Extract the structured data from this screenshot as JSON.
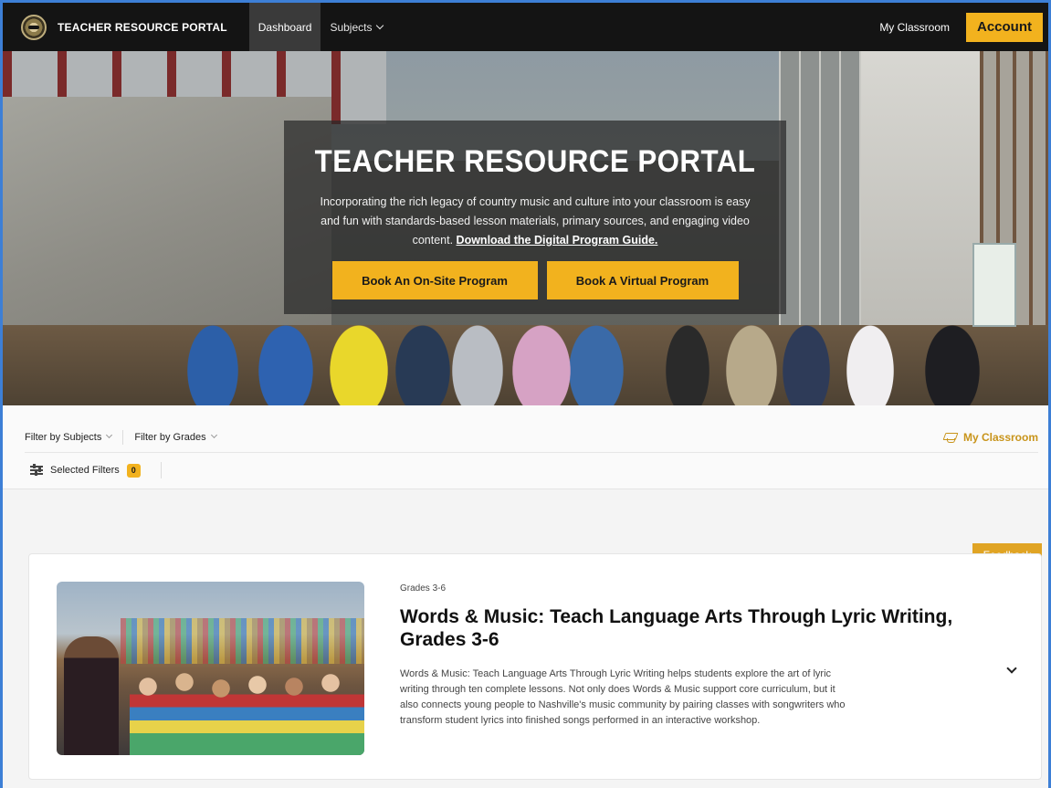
{
  "nav": {
    "brand": "TEACHER RESOURCE PORTAL",
    "links": [
      {
        "label": "Dashboard",
        "active": true
      },
      {
        "label": "Subjects",
        "active": false
      }
    ],
    "my_classroom": "My Classroom",
    "account": "Account"
  },
  "hero": {
    "title": "TEACHER RESOURCE PORTAL",
    "text": "Incorporating the rich legacy of country music and culture into your classroom is easy and fun with standards-based lesson materials, primary sources, and engaging video content.",
    "link": "Download the Digital Program Guide.",
    "button_onsite": "Book An On-Site Program",
    "button_virtual": "Book A Virtual Program"
  },
  "filters": {
    "subjects": "Filter by Subjects",
    "grades": "Filter by Grades",
    "my_classroom": "My Classroom",
    "selected_label": "Selected Filters",
    "selected_count": "0"
  },
  "feedback": "Feedback",
  "card": {
    "tag": "Grades 3-6",
    "title": "Words & Music: Teach Language Arts Through Lyric Writing, Grades 3-6",
    "description": "Words & Music: Teach Language Arts Through Lyric Writing helps students explore the art of lyric writing through ten complete lessons. Not only does Words & Music support core curriculum, but it also connects young people to Nashville's music community by pairing classes with songwriters who transform student lyrics into finished songs performed in an interactive workshop."
  },
  "colors": {
    "accent": "#f2b21e",
    "nav_bg": "#141414",
    "link_gold": "#c8941a",
    "feedback": "#e0a424"
  }
}
